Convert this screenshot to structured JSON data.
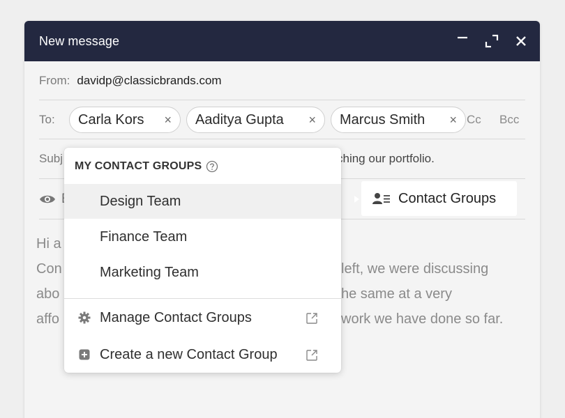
{
  "window": {
    "title": "New message"
  },
  "from": {
    "label": "From:",
    "value": "davidp@classicbrands.com"
  },
  "to": {
    "label": "To:",
    "recipients": [
      "Carla Kors",
      "Aaditya Gupta",
      "Marcus Smith"
    ],
    "remove_glyph": "×",
    "cc_label": "Cc",
    "bcc_label": "Bcc"
  },
  "subject": {
    "label_visible": "Subj",
    "text_visible": "ching our portfolio."
  },
  "toolbar": {
    "eye_letter": "E",
    "contact_groups_label": "Contact Groups"
  },
  "body_lines": [
    "Hi a",
    "Con",
    "abo",
    "affo"
  ],
  "body_lines_right": [
    "left, we were discussing",
    "he same at a very",
    "work we have done so far."
  ],
  "dropdown": {
    "header": "MY CONTACT GROUPS",
    "groups": [
      "Design Team",
      "Finance Team",
      "Marketing Team"
    ],
    "manage_label": "Manage Contact Groups",
    "create_label": "Create a new Contact Group"
  },
  "colors": {
    "titlebar": "#232840",
    "background": "#efefef",
    "panel": "#f4f4f4"
  },
  "icons": [
    "minimize-icon",
    "expand-icon",
    "close-icon",
    "eye-icon",
    "contact-groups-icon",
    "help-icon",
    "gear-icon",
    "plus-square-icon",
    "external-link-icon"
  ]
}
